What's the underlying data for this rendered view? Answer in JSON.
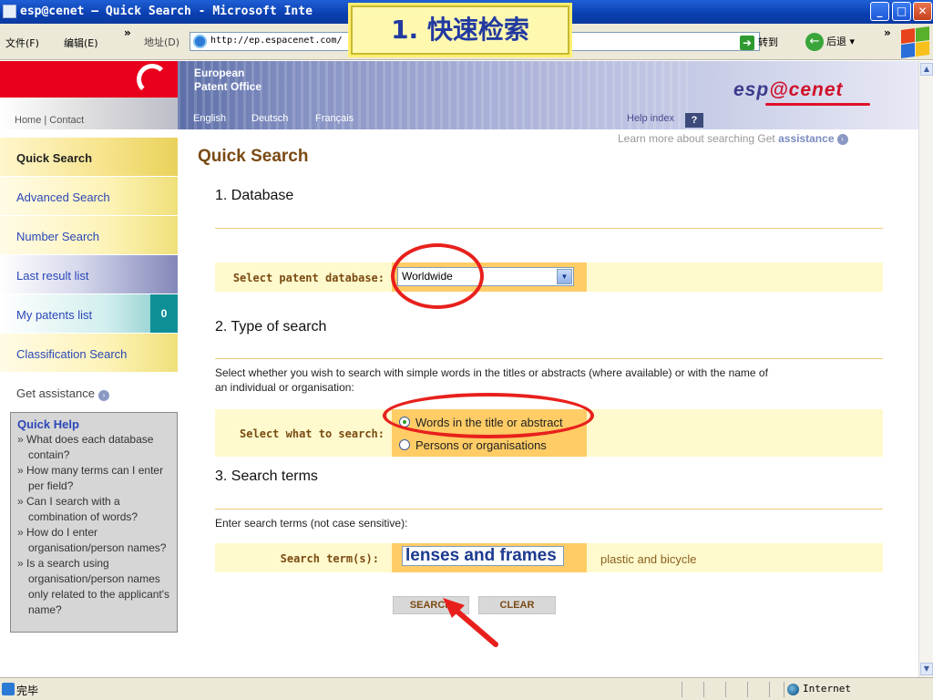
{
  "window": {
    "title": "esp@cenet — Quick Search - Microsoft Inte"
  },
  "menubar": {
    "file": "文件(F)",
    "edit": "编辑(E)",
    "more": "»",
    "address_label": "地址(D)",
    "address_url": "http://ep.espacenet.com/",
    "go_label": "转到",
    "back_label": "后退",
    "more_right": "»"
  },
  "overlay": {
    "label": "1.  快速检索"
  },
  "header": {
    "org_line1": "European",
    "org_line2": "Patent Office",
    "home_contact": "Home | Contact",
    "languages": [
      "English",
      "Deutsch",
      "Français"
    ],
    "help_index": "Help index",
    "help_q": "?",
    "brand_a": "esp",
    "brand_at": "@",
    "brand_b": "cenet"
  },
  "learn": {
    "text": "Learn more about searching Get ",
    "bold": "assistance",
    "icon": "›"
  },
  "sidebar": {
    "items": [
      {
        "label": "Quick Search"
      },
      {
        "label": "Advanced Search"
      },
      {
        "label": "Number Search"
      },
      {
        "label": "Last result list"
      },
      {
        "label": "My patents list",
        "count": "0"
      },
      {
        "label": "Classification Search"
      },
      {
        "label": "Get assistance",
        "icon": "›"
      }
    ]
  },
  "quickhelp": {
    "title": "Quick Help",
    "items": [
      "What does each database contain?",
      "How many terms can I enter per field?",
      "Can I search with a combination of words?",
      "How do I enter organisation/person names?",
      "Is a search using organisation/person names only related to the applicant's name?"
    ]
  },
  "main": {
    "title": "Quick Search",
    "section1": {
      "head": "1. Database",
      "label": "Select patent database:",
      "value": "Worldwide"
    },
    "section2": {
      "head": "2. Type of search",
      "text": "Select whether you wish to search with simple words in the titles or abstracts (where available) or with the name of an individual or organisation:",
      "label": "Select what to search:",
      "option1": "Words in the title or abstract",
      "option2": "Persons or organisations",
      "selected": "option1"
    },
    "section3": {
      "head": "3. Search terms",
      "text": "Enter search terms (not case sensitive):",
      "label": "Search term(s):",
      "value": "lenses and frames",
      "hint": "plastic and bicycle"
    },
    "buttons": {
      "search": "SEARCH",
      "clear": "CLEAR"
    }
  },
  "statusbar": {
    "status": "完毕",
    "zone": "Internet"
  },
  "colors": {
    "annotation": "#e8201c",
    "brand_red": "#e8001c",
    "accent_brown": "#7a4a12",
    "link_blue": "#2b47b8"
  }
}
